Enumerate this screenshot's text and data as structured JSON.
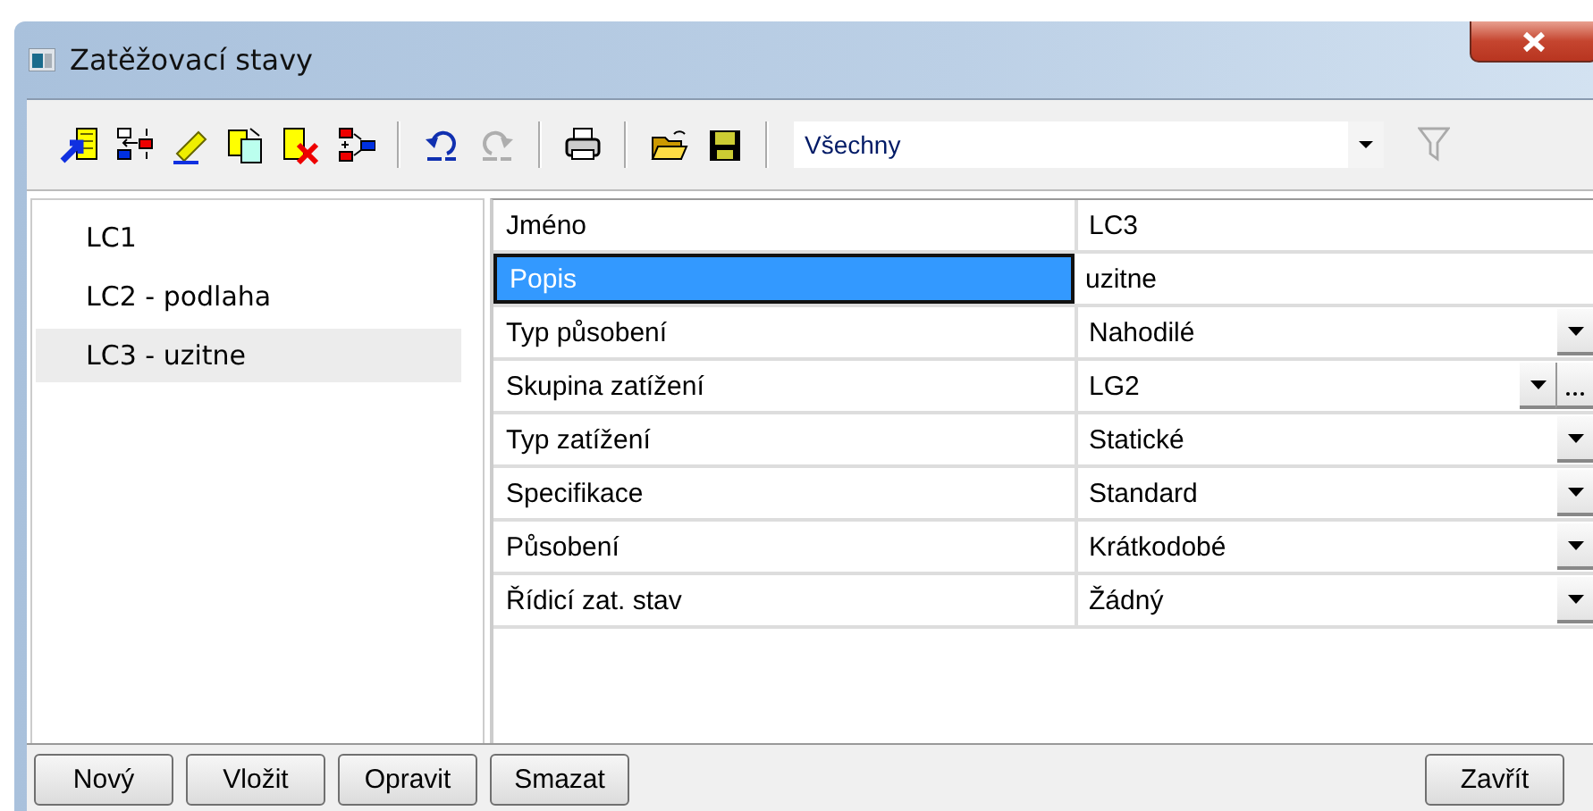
{
  "window": {
    "title": "Zatěžovací stavy"
  },
  "toolbar": {
    "buttons": [
      {
        "kind": "add",
        "disabled": false
      },
      {
        "kind": "insert",
        "disabled": false
      },
      {
        "kind": "edit",
        "disabled": false
      },
      {
        "kind": "copy",
        "disabled": false
      },
      {
        "kind": "delete",
        "disabled": false
      },
      {
        "kind": "merge",
        "disabled": false
      },
      {
        "kind": "separator"
      },
      {
        "kind": "undo",
        "disabled": false
      },
      {
        "kind": "redo",
        "disabled": true
      },
      {
        "kind": "separator"
      },
      {
        "kind": "print",
        "disabled": false
      },
      {
        "kind": "separator"
      },
      {
        "kind": "open",
        "disabled": false
      },
      {
        "kind": "save",
        "disabled": false
      },
      {
        "kind": "separator"
      }
    ],
    "filter_combo": {
      "value": "Všechny"
    },
    "filter_disabled": true
  },
  "load_cases": [
    {
      "label": "LC1",
      "selected": false
    },
    {
      "label": "LC2 - podlaha",
      "selected": false
    },
    {
      "label": "LC3 - uzitne",
      "selected": true
    }
  ],
  "properties": [
    {
      "name": "Jméno",
      "value": "LC3",
      "kind": "text",
      "selected": false
    },
    {
      "name": "Popis",
      "value": "uzitne",
      "kind": "text",
      "selected": true
    },
    {
      "name": "Typ působení",
      "value": "Nahodilé",
      "kind": "dropdown",
      "selected": false
    },
    {
      "name": "Skupina zatížení",
      "value": "LG2",
      "kind": "dropdown-browse",
      "selected": false
    },
    {
      "name": "Typ zatížení",
      "value": "Statické",
      "kind": "dropdown",
      "selected": false
    },
    {
      "name": "Specifikace",
      "value": "Standard",
      "kind": "dropdown",
      "selected": false
    },
    {
      "name": "Působení",
      "value": "Krátkodobé",
      "kind": "dropdown",
      "selected": false
    },
    {
      "name": "Řídicí zat. stav",
      "value": "Žádný",
      "kind": "dropdown",
      "selected": false
    }
  ],
  "buttons_left": [
    "Nový",
    "Vložit",
    "Opravit",
    "Smazat"
  ],
  "buttons_right": [
    "Zavřít"
  ]
}
